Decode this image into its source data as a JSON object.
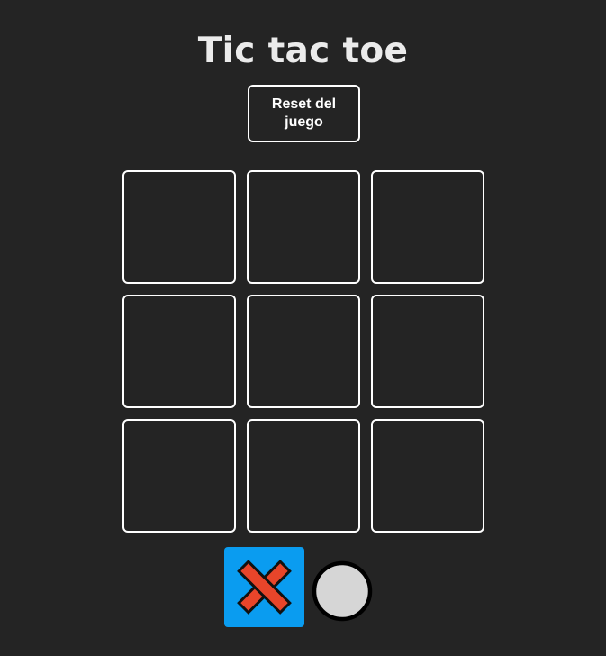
{
  "title": "Tic tac toe",
  "reset_label": "Reset del juego",
  "board": {
    "cells": [
      "",
      "",
      "",
      "",
      "",
      "",
      "",
      "",
      ""
    ]
  },
  "turn_indicator": {
    "active": "X",
    "x_icon": "x-mark-icon",
    "o_icon": "circle-icon"
  },
  "colors": {
    "background": "#242424",
    "active_turn": "#0a9cf0",
    "x_fill": "#e8452a",
    "o_fill": "#d6d6d6"
  }
}
